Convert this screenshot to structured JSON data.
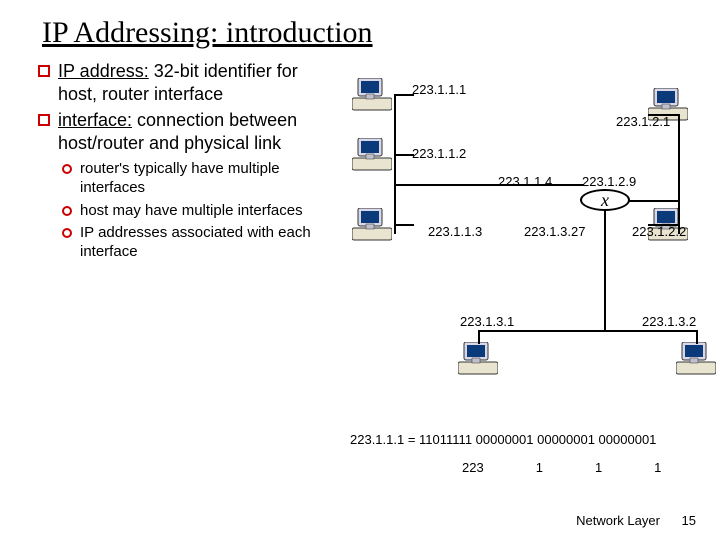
{
  "title": "IP Addressing: introduction",
  "bullets": [
    {
      "term": "IP address:",
      "rest": " 32-bit identifier for host, router interface"
    },
    {
      "term": "interface:",
      "rest": " connection between host/router and physical link"
    }
  ],
  "subbullets": [
    "router's typically have multiple interfaces",
    "host may have multiple interfaces",
    "IP addresses associated with each interface"
  ],
  "diagram": {
    "labels": {
      "a1": "223.1.1.1",
      "a2": "223.1.1.2",
      "a3": "223.1.1.3",
      "a4": "223.1.1.4",
      "b1": "223.1.2.1",
      "b2": "223.1.2.2",
      "b9": "223.1.2.9",
      "c27": "223.1.3.27",
      "d1": "223.1.3.1",
      "d2": "223.1.3.2"
    },
    "router": "x"
  },
  "binary": {
    "line": "223.1.1.1 = 11011111 00000001 00000001 00000001",
    "octets": [
      "223",
      "1",
      "1",
      "1"
    ]
  },
  "footer": {
    "section": "Network Layer",
    "page": "15"
  }
}
